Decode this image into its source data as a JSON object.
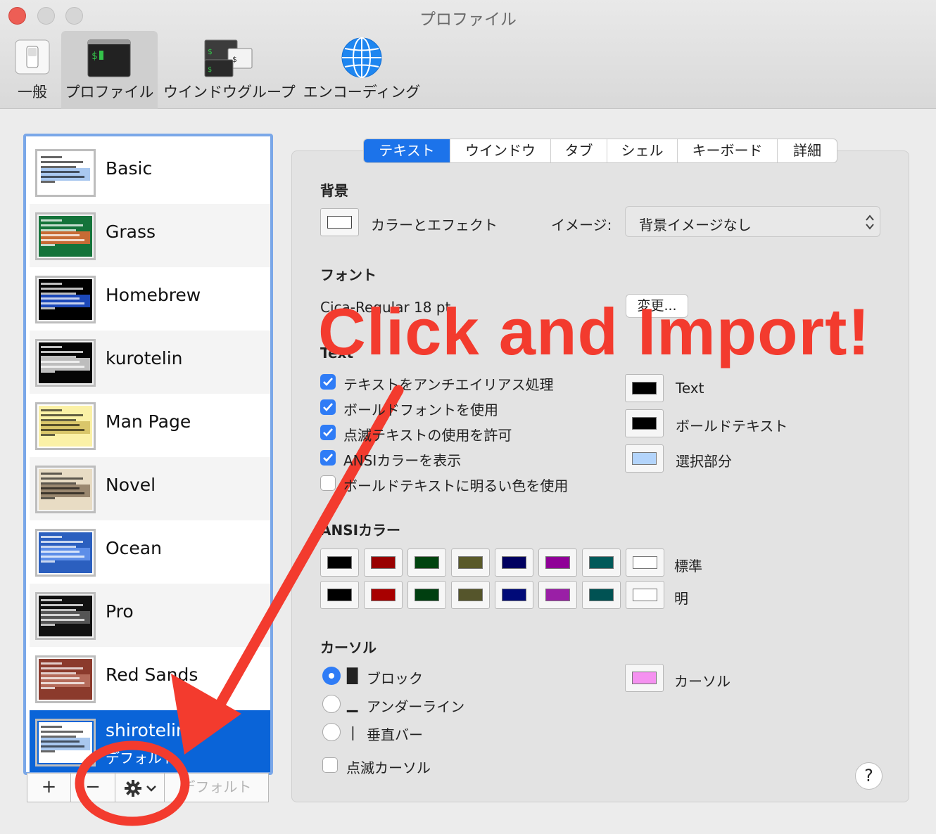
{
  "window": {
    "title": "プロファイル"
  },
  "toolbar": {
    "items": [
      {
        "label": "一般",
        "icon": "switch-icon"
      },
      {
        "label": "プロファイル",
        "icon": "terminal-icon",
        "selected": true
      },
      {
        "label": "ウインドウグループ",
        "icon": "window-group-icon"
      },
      {
        "label": "エンコーディング",
        "icon": "globe-icon"
      }
    ]
  },
  "profiles": [
    {
      "name": "Basic",
      "bg": "#ffffff",
      "highlight": "#a9c8ef"
    },
    {
      "name": "Grass",
      "bg": "#14733a",
      "highlight": "#c76b35"
    },
    {
      "name": "Homebrew",
      "bg": "#000000",
      "highlight": "#1c48b8"
    },
    {
      "name": "kurotelin",
      "bg": "#050505",
      "highlight": "#bdbdbd"
    },
    {
      "name": "Man Page",
      "bg": "#fbf1a6",
      "highlight": "#d9c66a"
    },
    {
      "name": "Novel",
      "bg": "#e8dcc4",
      "highlight": "#9a8870"
    },
    {
      "name": "Ocean",
      "bg": "#2b5fbf",
      "highlight": "#5d8ee8"
    },
    {
      "name": "Pro",
      "bg": "#111111",
      "highlight": "#555555"
    },
    {
      "name": "Red Sands",
      "bg": "#8b3a2c",
      "highlight": "#b46a5a"
    },
    {
      "name": "shirotelin",
      "sub": "デフォルト",
      "bg": "#ffffff",
      "highlight": "#a9c8ef",
      "selected": true
    }
  ],
  "bottom_buttons": {
    "add": "+",
    "remove": "−",
    "default": "デフォルト"
  },
  "tabs": [
    "テキスト",
    "ウインドウ",
    "タブ",
    "シェル",
    "キーボード",
    "詳細"
  ],
  "background": {
    "heading": "背景",
    "color_effect_label": "カラーとエフェクト",
    "image_label": "イメージ:",
    "image_value": "背景イメージなし"
  },
  "font": {
    "heading": "フォント",
    "value": "Cica-Regular 18 pt.",
    "change_label": "変更..."
  },
  "text": {
    "heading": "Text",
    "options": [
      {
        "label": "テキストをアンチエイリアス処理",
        "checked": true
      },
      {
        "label": "ボールドフォントを使用",
        "checked": true
      },
      {
        "label": "点滅テキストの使用を許可",
        "checked": true
      },
      {
        "label": "ANSIカラーを表示",
        "checked": true
      },
      {
        "label": "ボールドテキストに明るい色を使用",
        "checked": false
      }
    ],
    "colors": [
      {
        "label": "Text",
        "color": "#000000"
      },
      {
        "label": "ボールドテキスト",
        "color": "#000000"
      },
      {
        "label": "選択部分",
        "color": "#b3d4fb"
      }
    ]
  },
  "ansi": {
    "heading": "ANSIカラー",
    "normal_label": "標準",
    "bright_label": "明",
    "normal": [
      "#000000",
      "#990000",
      "#00440f",
      "#5a5a2a",
      "#000060",
      "#8f0097",
      "#005a5a",
      "#ffffff"
    ],
    "bright": [
      "#000000",
      "#a80000",
      "#003f10",
      "#55552b",
      "#000a78",
      "#9a1fa6",
      "#005253",
      "#ffffff"
    ]
  },
  "cursor": {
    "heading": "カーソル",
    "options": [
      {
        "glyph": "█",
        "label": "ブロック",
        "selected": true
      },
      {
        "glyph": "▁",
        "label": "アンダーライン",
        "selected": false
      },
      {
        "glyph": "❘",
        "label": "垂直バー",
        "selected": false
      }
    ],
    "blink_label": "点滅カーソル",
    "color_label": "カーソル",
    "color": "#f591f0"
  },
  "help_label": "?",
  "annotation": {
    "text": "Click and Import!",
    "color": "#f33b2e"
  }
}
